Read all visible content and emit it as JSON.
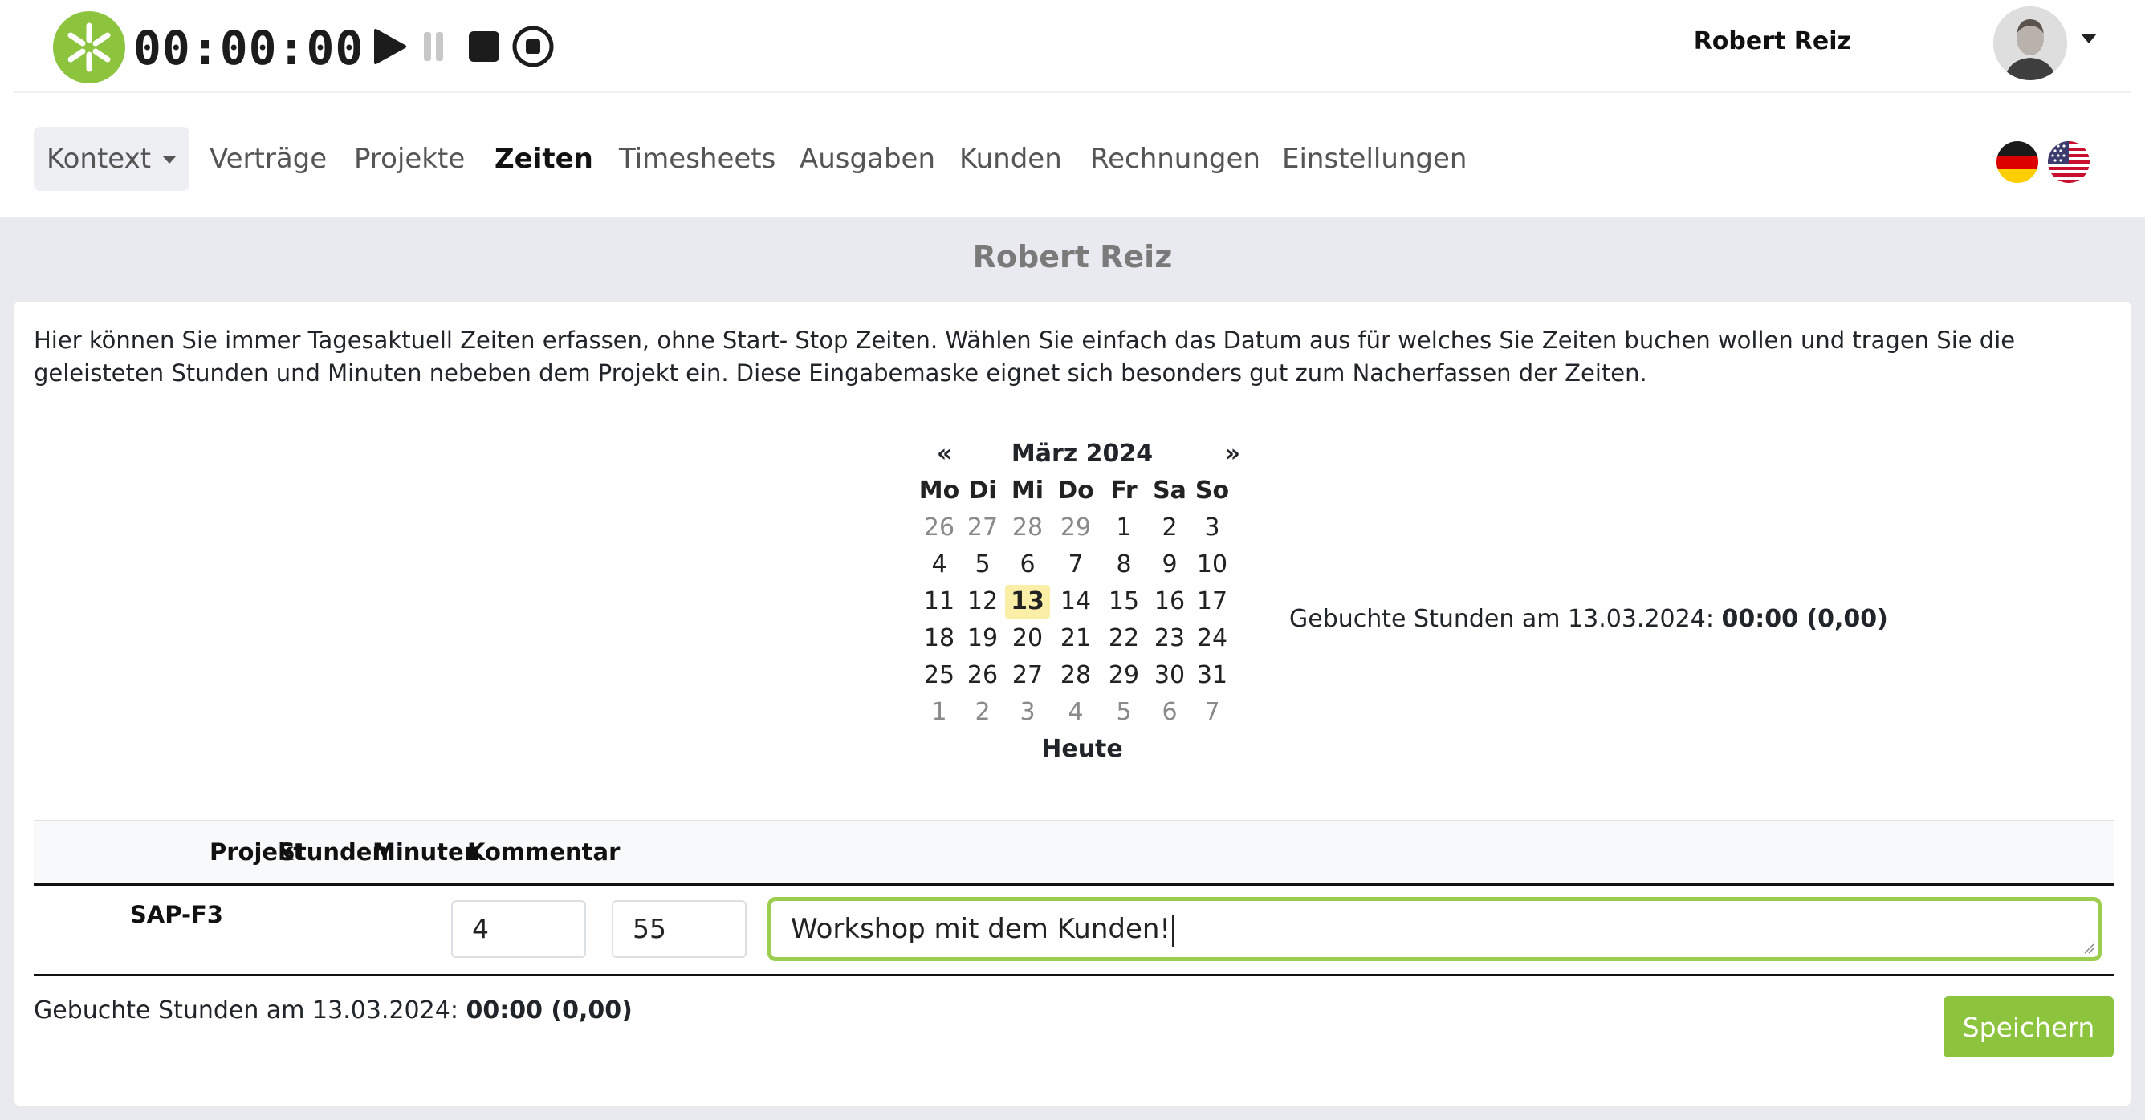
{
  "header": {
    "timer": "00:00:00",
    "user_name": "Robert Reiz"
  },
  "nav": {
    "context_label": "Kontext",
    "items": [
      {
        "label": "Verträge"
      },
      {
        "label": "Projekte"
      },
      {
        "label": "Zeiten",
        "active": true
      },
      {
        "label": "Timesheets"
      },
      {
        "label": "Ausgaben"
      },
      {
        "label": "Kunden"
      },
      {
        "label": "Rechnungen"
      },
      {
        "label": "Einstellungen"
      }
    ],
    "languages": [
      "german-flag-icon",
      "us-flag-icon"
    ]
  },
  "page": {
    "title": "Robert Reiz",
    "intro": "Hier können Sie immer Tagesaktuell Zeiten erfassen, ohne Start- Stop Zeiten. Wählen Sie einfach das Datum aus für welches Sie Zeiten buchen wollen und tragen Sie die geleisteten Stunden und Minuten nebeben dem Projekt ein. Diese Eingabemaske eignet sich besonders gut zum Nacherfassen der Zeiten."
  },
  "calendar": {
    "prev": "«",
    "next": "»",
    "title": "März 2024",
    "weekdays": [
      "Mo",
      "Di",
      "Mi",
      "Do",
      "Fr",
      "Sa",
      "So"
    ],
    "weeks": [
      [
        "26",
        "27",
        "28",
        "29",
        "1",
        "2",
        "3"
      ],
      [
        "4",
        "5",
        "6",
        "7",
        "8",
        "9",
        "10"
      ],
      [
        "11",
        "12",
        "13",
        "14",
        "15",
        "16",
        "17"
      ],
      [
        "18",
        "19",
        "20",
        "21",
        "22",
        "23",
        "24"
      ],
      [
        "25",
        "26",
        "27",
        "28",
        "29",
        "30",
        "31"
      ],
      [
        "1",
        "2",
        "3",
        "4",
        "5",
        "6",
        "7"
      ]
    ],
    "selected": "13",
    "today_label": "Heute"
  },
  "booked": {
    "label": "Gebuchte Stunden am 13.03.2024:",
    "value": "00:00 (0,00)"
  },
  "table": {
    "headers": {
      "project": "Projekt",
      "hours": "Stunden",
      "minutes": "Minuten",
      "comment": "Kommentar"
    },
    "row": {
      "project": "SAP-F3",
      "hours": "4",
      "minutes": "55",
      "comment": "Workshop mit dem Kunden!"
    }
  },
  "save_label": "Speichern",
  "colors": {
    "brand_green": "#8cc43e",
    "focus_border": "#9ccd4f",
    "today_highlight": "#fbeea6",
    "page_bg": "#e8eaf0"
  }
}
